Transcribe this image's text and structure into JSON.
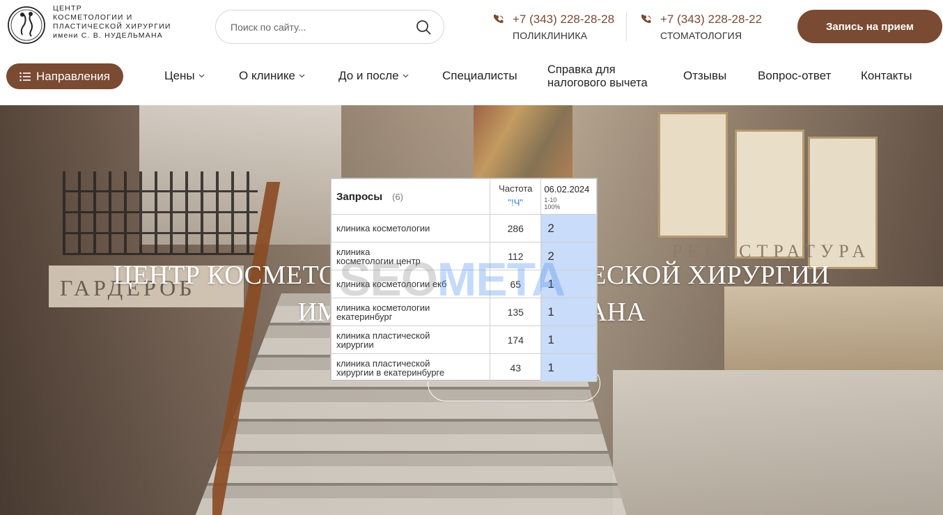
{
  "logo": {
    "lines": [
      "ЦЕНТР",
      "КОСМЕТОЛОГИИ И",
      "ПЛАСТИЧЕСКОЙ ХИРУРГИИ",
      "имени С. В. НУДЕЛЬМАНА"
    ]
  },
  "search": {
    "placeholder": "Поиск по сайту..."
  },
  "phones": [
    {
      "number": "+7 (343) 228-28-28",
      "label": "ПОЛИКЛИНИКА"
    },
    {
      "number": "+7 (343) 228-28-22",
      "label": "СТОМАТОЛОГИЯ"
    }
  ],
  "cta_label": "Запись на прием",
  "nav": {
    "directions_label": "Направления",
    "items": [
      {
        "label": "Цены"
      },
      {
        "label": "О клинике"
      },
      {
        "label": "До и после"
      },
      {
        "label": "Специалисты"
      },
      {
        "label_line1": "Справка для",
        "label_line2": "налогового вычета"
      },
      {
        "label": "Отзывы"
      },
      {
        "label": "Вопрос-ответ"
      },
      {
        "label": "Контакты"
      }
    ]
  },
  "hero": {
    "title_line1": "ЦЕНТР КОСМЕТОЛОГИИ И ПЛАСТИЧЕСКОЙ ХИРУРГИИ",
    "title_line2": "ИМЕНИ С. В. НУДЕЛЬМАНА",
    "sign_left": "ГАРДЕРОБ",
    "sign_right": "РЕГИСТРАТУРА"
  },
  "seo_table": {
    "title": "Запросы",
    "count": "(6)",
    "freq_header": "Частота",
    "freq_operator": "\"!Ч\"",
    "date_header": "06.02.2024",
    "date_range": "1-10",
    "date_percent": "100%",
    "watermark_a": "SEO",
    "watermark_b": "META",
    "rows": [
      {
        "query": "клиника косметологии",
        "freq": "286",
        "pos": "2"
      },
      {
        "query": "клиника косметологии центр",
        "freq": "112",
        "pos": "2"
      },
      {
        "query": "клиника косметологии екб",
        "freq": "65",
        "pos": "1"
      },
      {
        "query": "клиника косметологии екатеринбург",
        "freq": "135",
        "pos": "1"
      },
      {
        "query": "клиника пластической хирургии",
        "freq": "174",
        "pos": "1"
      },
      {
        "query": "клиника пластической хирургии в екатеринбурге",
        "freq": "43",
        "pos": "1"
      }
    ]
  },
  "colors": {
    "brand": "#7a4a32",
    "highlight": "#c9dcf9",
    "link": "#2f7fd9"
  }
}
